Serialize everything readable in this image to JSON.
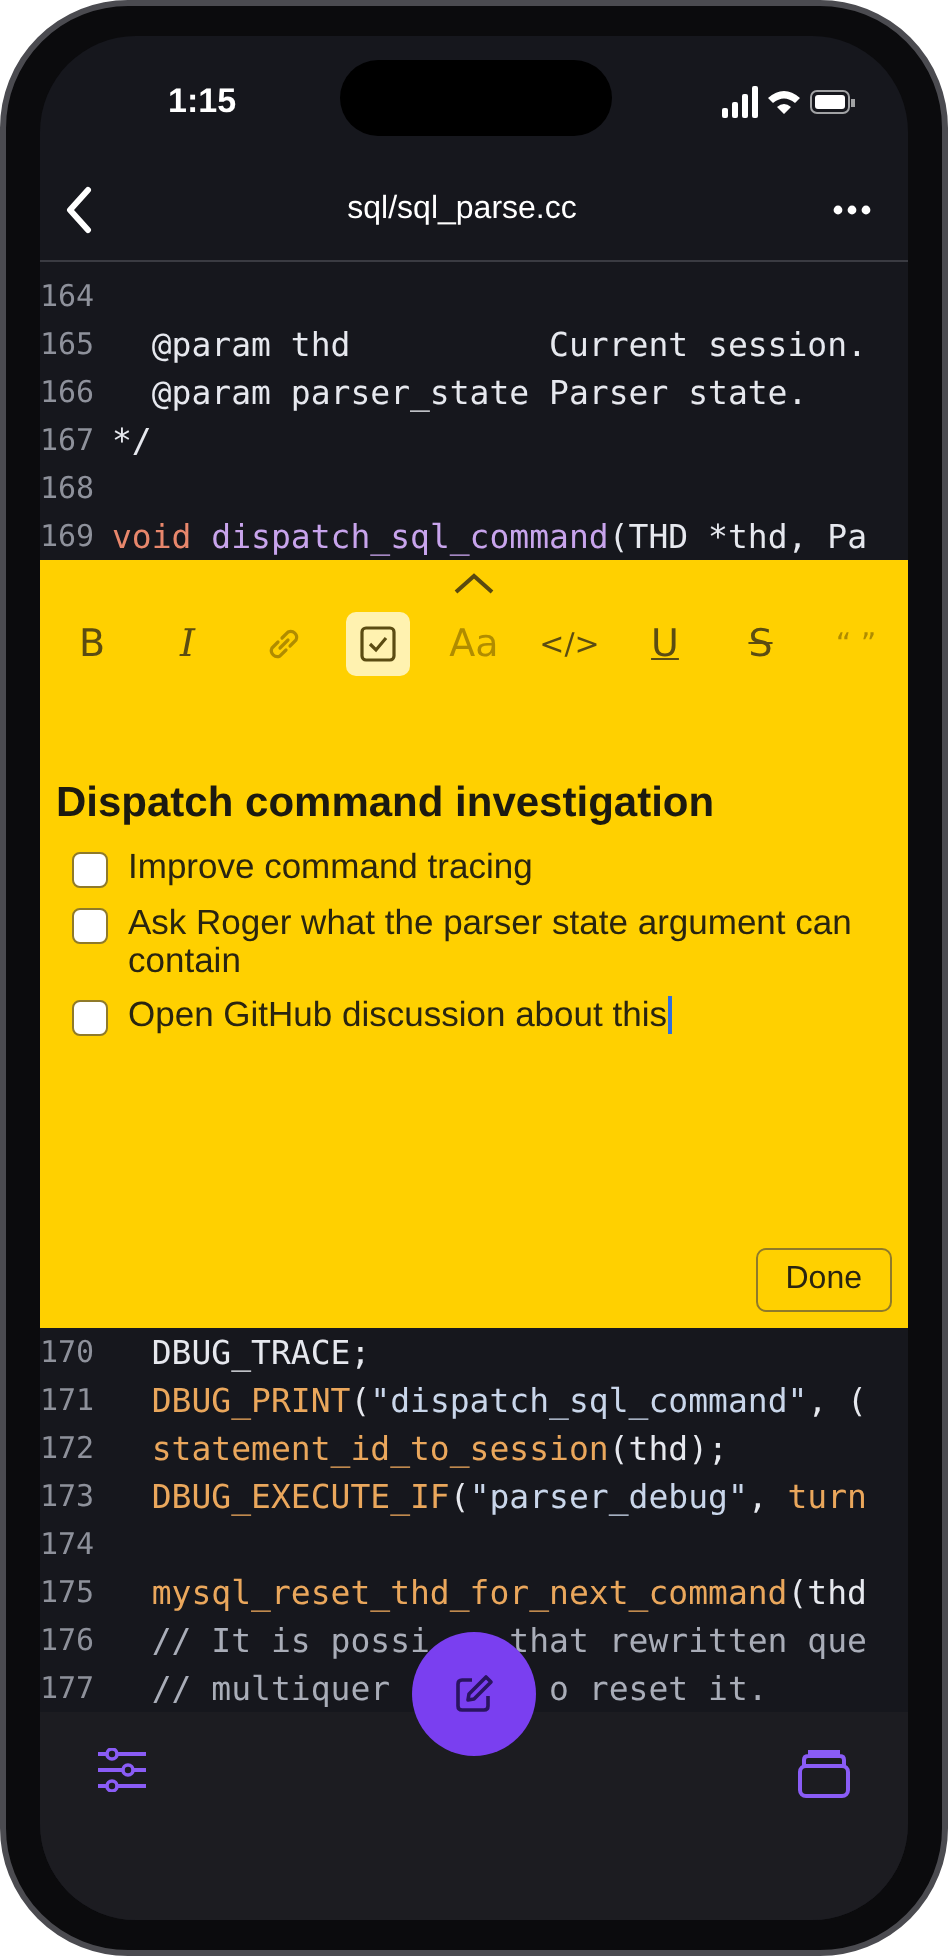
{
  "status_bar": {
    "time": "1:15"
  },
  "nav": {
    "title": "sql/sql_parse.cc"
  },
  "code_top": [
    {
      "number": "164"
    },
    {
      "number": "165",
      "indent": true,
      "tokens": [
        {
          "text": "@param thd          Current session.",
          "kind": "plain"
        }
      ]
    },
    {
      "number": "166",
      "indent": true,
      "tokens": [
        {
          "text": "@param parser_state Parser state.",
          "kind": "plain"
        }
      ]
    },
    {
      "number": "167",
      "indent": false,
      "tokens": [
        {
          "text": "*/",
          "kind": "plain"
        }
      ]
    },
    {
      "number": "168"
    },
    {
      "number": "169",
      "indent": false,
      "tokens": [
        {
          "text": "void",
          "kind": "keyword"
        },
        {
          "text": "dispatch_sql_command",
          "kind": "function",
          "space_before": true
        },
        {
          "text": "(THD *thd, Pa",
          "kind": "plain"
        }
      ]
    }
  ],
  "note": {
    "toolbar": [
      {
        "kind": "bold",
        "label": "B",
        "selected": false,
        "disabled": false
      },
      {
        "kind": "italic",
        "label": "I",
        "selected": false,
        "disabled": false
      },
      {
        "kind": "link",
        "selected": false,
        "disabled": true
      },
      {
        "kind": "checklist",
        "selected": true,
        "disabled": false
      },
      {
        "kind": "text",
        "label": "Aa",
        "selected": false,
        "disabled": true
      },
      {
        "kind": "code",
        "label": "</>",
        "selected": false,
        "disabled": false
      },
      {
        "kind": "underline",
        "label": "U",
        "selected": false,
        "disabled": false
      },
      {
        "kind": "strike",
        "label": "S",
        "selected": false,
        "disabled": false
      },
      {
        "kind": "quote",
        "label": "“ ”",
        "selected": false,
        "disabled": true
      }
    ],
    "title": "Dispatch command investigation",
    "items": [
      {
        "text": "Improve command tracing",
        "checked": false,
        "cursor": false
      },
      {
        "text": "Ask Roger what the parser state argument can contain",
        "checked": false,
        "cursor": false
      },
      {
        "text": "Open GitHub discussion about this",
        "checked": false,
        "cursor": true
      }
    ],
    "done_button": "Done"
  },
  "code_bottom": [
    {
      "number": "170",
      "indent": true,
      "tokens": [
        {
          "text": "DBUG_TRACE;",
          "kind": "plain"
        }
      ]
    },
    {
      "number": "171",
      "indent": true,
      "tokens": [
        {
          "text": "DBUG_PRINT",
          "kind": "call"
        },
        {
          "text": "(",
          "kind": "plain"
        },
        {
          "text": "\"dispatch_sql_command\"",
          "kind": "string"
        },
        {
          "text": ", (",
          "kind": "plain"
        }
      ]
    },
    {
      "number": "172",
      "indent": true,
      "tokens": [
        {
          "text": "statement_id_to_session",
          "kind": "call"
        },
        {
          "text": "(thd);",
          "kind": "plain"
        }
      ]
    },
    {
      "number": "173",
      "indent": true,
      "tokens": [
        {
          "text": "DBUG_EXECUTE_IF",
          "kind": "call"
        },
        {
          "text": "(",
          "kind": "plain"
        },
        {
          "text": "\"parser_debug\"",
          "kind": "string"
        },
        {
          "text": ",",
          "kind": "plain"
        },
        {
          "text": "turn",
          "kind": "call",
          "space_before": true
        }
      ]
    },
    {
      "number": "174"
    },
    {
      "number": "175",
      "indent": true,
      "tokens": [
        {
          "text": "mysql_reset_thd_for_next_command",
          "kind": "call"
        },
        {
          "text": "(thd",
          "kind": "plain"
        }
      ]
    },
    {
      "number": "176",
      "indent": true,
      "tokens": [
        {
          "text": "// It is possi    that rewritten que",
          "kind": "comment"
        }
      ]
    },
    {
      "number": "177",
      "indent": true,
      "tokens": [
        {
          "text": "// multiquer",
          "kind": "comment"
        },
        {
          "text": "o reset it.",
          "kind": "comment",
          "covered_before": true
        }
      ]
    }
  ]
}
